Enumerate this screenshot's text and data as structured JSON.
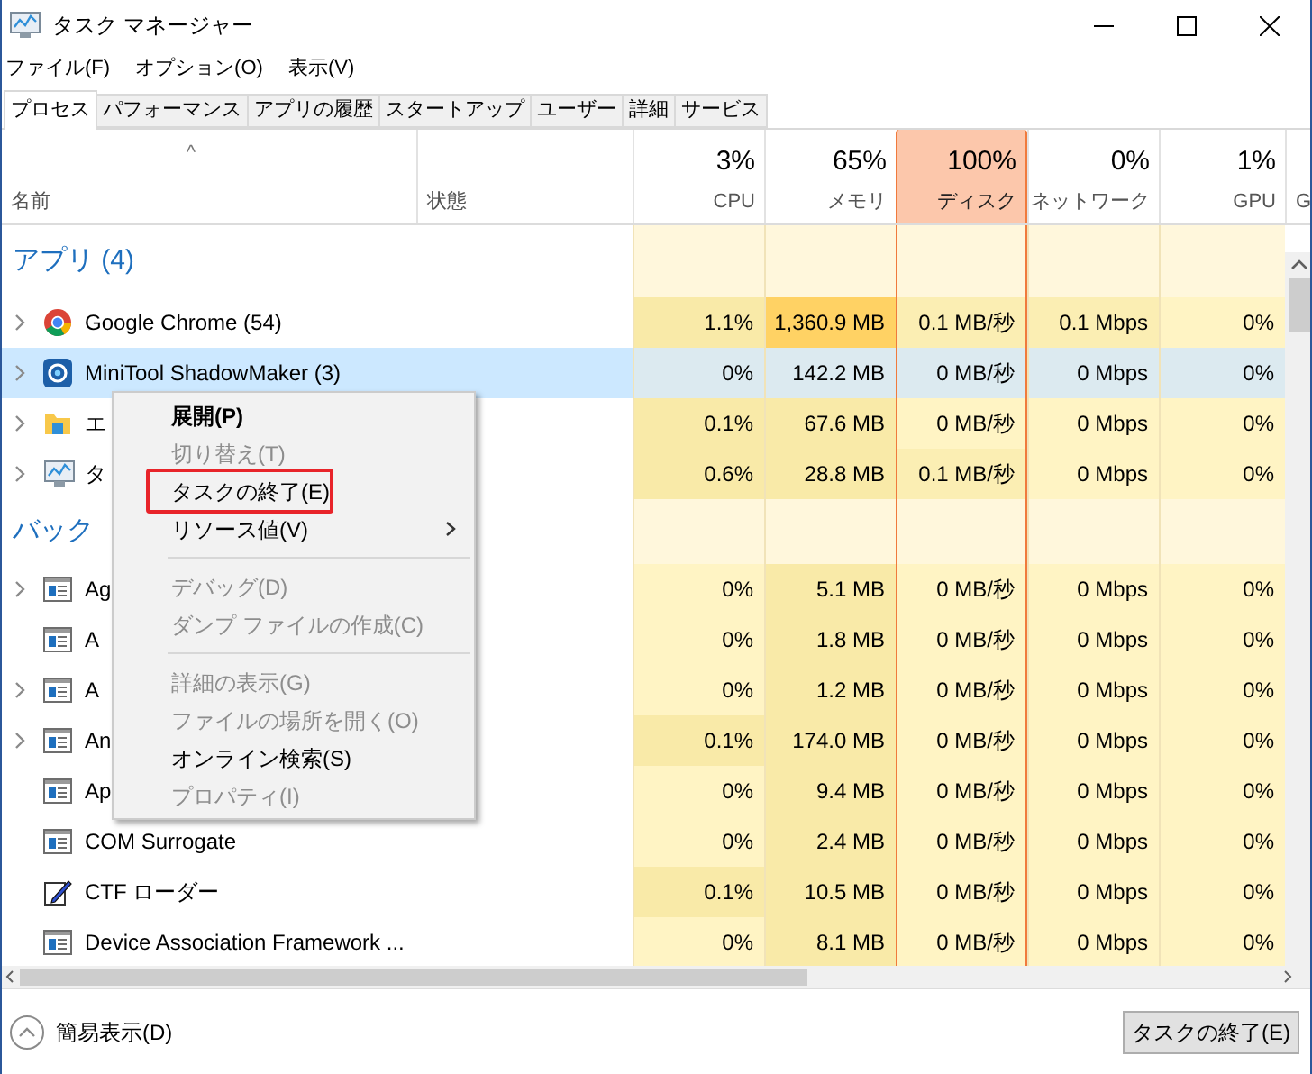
{
  "window": {
    "title": "タスク マネージャー"
  },
  "menu_bar": [
    "ファイル(F)",
    "オプション(O)",
    "表示(V)"
  ],
  "tabs": [
    {
      "label": "プロセス",
      "selected": true
    },
    {
      "label": "パフォーマンス",
      "selected": false
    },
    {
      "label": "アプリの履歴",
      "selected": false
    },
    {
      "label": "スタートアップ",
      "selected": false
    },
    {
      "label": "ユーザー",
      "selected": false
    },
    {
      "label": "詳細",
      "selected": false
    },
    {
      "label": "サービス",
      "selected": false
    }
  ],
  "columns": [
    {
      "label": "名前",
      "sort_caret": "^"
    },
    {
      "label": "状態"
    },
    {
      "percent": "3%",
      "label": "CPU",
      "highlighted": false
    },
    {
      "percent": "65%",
      "label": "メモリ",
      "highlighted": false
    },
    {
      "percent": "100%",
      "label": "ディスク",
      "highlighted": true
    },
    {
      "percent": "0%",
      "label": "ネットワーク",
      "highlighted": false
    },
    {
      "percent": "1%",
      "label": "GPU",
      "highlighted": false
    },
    {
      "label": "G"
    }
  ],
  "rows": [
    {
      "kind": "group",
      "label": "アプリ (4)"
    },
    {
      "kind": "browser",
      "expandable": true,
      "selected": false,
      "name": "Google Chrome (54)",
      "cells": [
        {
          "v": "1.1%",
          "color": "#f9eaa8"
        },
        {
          "v": "1,360.9 MB",
          "color": "#ffd264"
        },
        {
          "v": "0.1 MB/秒",
          "color": "#fbeeb3"
        },
        {
          "v": "0.1 Mbps",
          "color": "#fbeeb3"
        },
        {
          "v": "0%",
          "color": "#fff4c4"
        }
      ]
    },
    {
      "kind": "app",
      "expandable": true,
      "selected": true,
      "name": "MiniTool ShadowMaker (3)",
      "cells": [
        {
          "v": "0%",
          "color": "#dceaf0"
        },
        {
          "v": "142.2 MB",
          "color": "#dceaf0"
        },
        {
          "v": "0 MB/秒",
          "color": "#dceaf0"
        },
        {
          "v": "0 Mbps",
          "color": "#dceaf0"
        },
        {
          "v": "0%",
          "color": "#dceaf0"
        }
      ]
    },
    {
      "kind": "folder",
      "expandable": true,
      "selected": false,
      "name": "エ",
      "cells": [
        {
          "v": "0.1%",
          "color": "#f9eaa8"
        },
        {
          "v": "67.6 MB",
          "color": "#f9eaa8"
        },
        {
          "v": "0 MB/秒",
          "color": "#fff4c4"
        },
        {
          "v": "0 Mbps",
          "color": "#fff4c4"
        },
        {
          "v": "0%",
          "color": "#fff4c4"
        }
      ]
    },
    {
      "kind": "monitor",
      "expandable": true,
      "selected": false,
      "name": "タ",
      "cells": [
        {
          "v": "0.6%",
          "color": "#f9eaa8"
        },
        {
          "v": "28.8 MB",
          "color": "#f9eaa8"
        },
        {
          "v": "0.1 MB/秒",
          "color": "#fbeeb3"
        },
        {
          "v": "0 Mbps",
          "color": "#fff4c4"
        },
        {
          "v": "0%",
          "color": "#fff4c4"
        }
      ]
    },
    {
      "kind": "group",
      "label": "バック"
    },
    {
      "kind": "service",
      "expandable": true,
      "selected": false,
      "name": "Ag",
      "cells": [
        {
          "v": "0%",
          "color": "#fff4c4"
        },
        {
          "v": "5.1 MB",
          "color": "#f9eaa8"
        },
        {
          "v": "0 MB/秒",
          "color": "#fff4c4"
        },
        {
          "v": "0 Mbps",
          "color": "#fff4c4"
        },
        {
          "v": "0%",
          "color": "#fff4c4"
        }
      ]
    },
    {
      "kind": "service",
      "expandable": false,
      "selected": false,
      "name": "A",
      "cells": [
        {
          "v": "0%",
          "color": "#fff4c4"
        },
        {
          "v": "1.8 MB",
          "color": "#f9eaa8"
        },
        {
          "v": "0 MB/秒",
          "color": "#fff4c4"
        },
        {
          "v": "0 Mbps",
          "color": "#fff4c4"
        },
        {
          "v": "0%",
          "color": "#fff4c4"
        }
      ]
    },
    {
      "kind": "service",
      "expandable": true,
      "selected": false,
      "name": "A",
      "cells": [
        {
          "v": "0%",
          "color": "#fff4c4"
        },
        {
          "v": "1.2 MB",
          "color": "#f9eaa8"
        },
        {
          "v": "0 MB/秒",
          "color": "#fff4c4"
        },
        {
          "v": "0 Mbps",
          "color": "#fff4c4"
        },
        {
          "v": "0%",
          "color": "#fff4c4"
        }
      ]
    },
    {
      "kind": "service",
      "expandable": true,
      "selected": false,
      "name": "An",
      "cells": [
        {
          "v": "0.1%",
          "color": "#f9eaa8"
        },
        {
          "v": "174.0 MB",
          "color": "#f9eaa8"
        },
        {
          "v": "0 MB/秒",
          "color": "#fff4c4"
        },
        {
          "v": "0 Mbps",
          "color": "#fff4c4"
        },
        {
          "v": "0%",
          "color": "#fff4c4"
        }
      ]
    },
    {
      "kind": "service",
      "expandable": false,
      "selected": false,
      "name": "Ap",
      "cells": [
        {
          "v": "0%",
          "color": "#fff4c4"
        },
        {
          "v": "9.4 MB",
          "color": "#f9eaa8"
        },
        {
          "v": "0 MB/秒",
          "color": "#fff4c4"
        },
        {
          "v": "0 Mbps",
          "color": "#fff4c4"
        },
        {
          "v": "0%",
          "color": "#fff4c4"
        }
      ]
    },
    {
      "kind": "service",
      "expandable": false,
      "selected": false,
      "name": "COM Surrogate",
      "cells": [
        {
          "v": "0%",
          "color": "#fff4c4"
        },
        {
          "v": "2.4 MB",
          "color": "#f9eaa8"
        },
        {
          "v": "0 MB/秒",
          "color": "#fff4c4"
        },
        {
          "v": "0 Mbps",
          "color": "#fff4c4"
        },
        {
          "v": "0%",
          "color": "#fff4c4"
        }
      ]
    },
    {
      "kind": "notepad",
      "expandable": false,
      "selected": false,
      "name": "CTF ローダー",
      "cells": [
        {
          "v": "0.1%",
          "color": "#f9eaa8"
        },
        {
          "v": "10.5 MB",
          "color": "#f9eaa8"
        },
        {
          "v": "0 MB/秒",
          "color": "#fff4c4"
        },
        {
          "v": "0 Mbps",
          "color": "#fff4c4"
        },
        {
          "v": "0%",
          "color": "#fff4c4"
        }
      ]
    },
    {
      "kind": "service",
      "expandable": false,
      "selected": false,
      "name": "Device Association Framework ...",
      "cells": [
        {
          "v": "0%",
          "color": "#fff4c4"
        },
        {
          "v": "8.1 MB",
          "color": "#f9eaa8"
        },
        {
          "v": "0 MB/秒",
          "color": "#fff4c4"
        },
        {
          "v": "0 Mbps",
          "color": "#fff4c4"
        },
        {
          "v": "0%",
          "color": "#fff4c4"
        }
      ]
    }
  ],
  "context_menu": [
    {
      "kind": "item",
      "label": "展開(P)",
      "disabled": false,
      "default": true,
      "submenu": false,
      "outlined": false
    },
    {
      "kind": "item",
      "label": "切り替え(T)",
      "disabled": true,
      "default": false,
      "submenu": false,
      "outlined": false
    },
    {
      "kind": "item",
      "label": "タスクの終了(E)",
      "disabled": false,
      "default": false,
      "submenu": false,
      "outlined": true
    },
    {
      "kind": "item",
      "label": "リソース値(V)",
      "disabled": false,
      "default": false,
      "submenu": true,
      "outlined": false
    },
    {
      "kind": "separator"
    },
    {
      "kind": "item",
      "label": "デバッグ(D)",
      "disabled": true,
      "default": false,
      "submenu": false,
      "outlined": false
    },
    {
      "kind": "item",
      "label": "ダンプ ファイルの作成(C)",
      "disabled": true,
      "default": false,
      "submenu": false,
      "outlined": false
    },
    {
      "kind": "separator"
    },
    {
      "kind": "item",
      "label": "詳細の表示(G)",
      "disabled": true,
      "default": false,
      "submenu": false,
      "outlined": false
    },
    {
      "kind": "item",
      "label": "ファイルの場所を開く(O)",
      "disabled": true,
      "default": false,
      "submenu": false,
      "outlined": false
    },
    {
      "kind": "item",
      "label": "オンライン検索(S)",
      "disabled": false,
      "default": false,
      "submenu": false,
      "outlined": false
    },
    {
      "kind": "item",
      "label": "プロパティ(I)",
      "disabled": true,
      "default": false,
      "submenu": false,
      "outlined": false
    }
  ],
  "footer": {
    "fewer_details": "簡易表示(D)",
    "end_task_button": "タスクの終了(E)"
  }
}
